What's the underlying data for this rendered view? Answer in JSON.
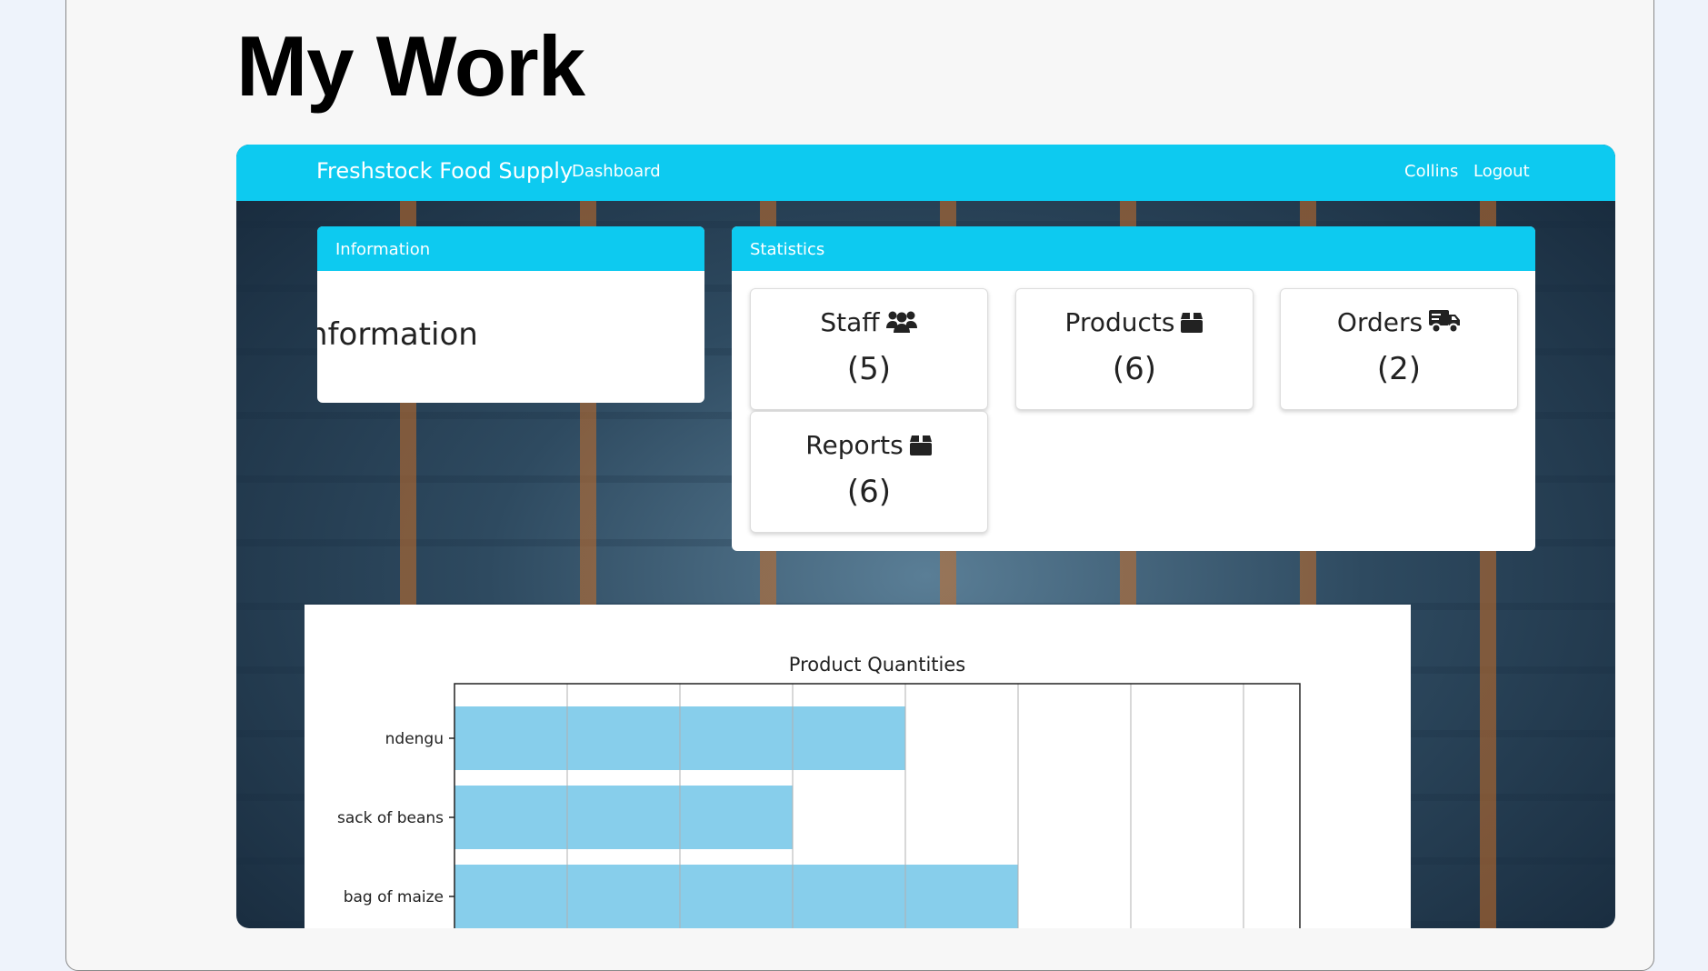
{
  "page": {
    "title": "My Work"
  },
  "navbar": {
    "brand": "Freshstock Food Supply",
    "dashboard_link": "Dashboard",
    "user": "Collins",
    "logout": "Logout"
  },
  "information_card": {
    "header": "Information",
    "body": "Information"
  },
  "statistics_card": {
    "header": "Statistics",
    "stats": [
      {
        "label": "Staff",
        "count": "(5)",
        "icon": "users-icon"
      },
      {
        "label": "Products",
        "count": "(6)",
        "icon": "box-icon"
      },
      {
        "label": "Orders",
        "count": "(2)",
        "icon": "truck-icon"
      },
      {
        "label": "Reports",
        "count": "(6)",
        "icon": "box-icon"
      }
    ]
  },
  "colors": {
    "accent": "#0dcaf0",
    "bar": "#87ceeb"
  },
  "chart_data": {
    "type": "bar",
    "orientation": "horizontal",
    "title": "Product Quantities",
    "categories": [
      "ndengu",
      "sack of beans",
      "bag of maize"
    ],
    "values": [
      40,
      30,
      50
    ],
    "xlim": [
      0,
      75
    ],
    "grid": true
  }
}
